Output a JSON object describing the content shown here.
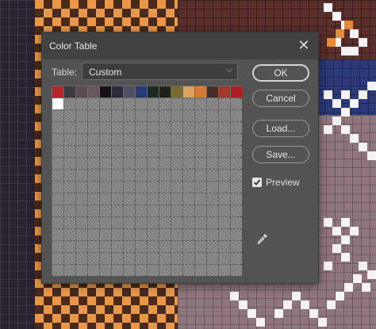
{
  "dialog": {
    "title": "Color Table",
    "close_icon": "close-icon",
    "table_label": "Table:",
    "table_value": "Custom",
    "buttons": {
      "ok": "OK",
      "cancel": "Cancel",
      "load": "Load...",
      "save": "Save..."
    },
    "preview": {
      "label": "Preview",
      "checked": true
    },
    "eyedropper_icon": "eyedropper-icon"
  },
  "swatches": {
    "colors": [
      "#b3262e",
      "#3c3a3e",
      "#5b4a52",
      "#6a585e",
      "#141214",
      "#2a2a3c",
      "#4d4f66",
      "#263a7a",
      "#1e2a20",
      "#1f2218",
      "#7a6a2e",
      "#e0a060",
      "#d87a30",
      "#4a2e26",
      "#a23a2a",
      "#b01e24"
    ],
    "second_row": [
      "#ffffff"
    ],
    "empty_color": "#8f8f8f",
    "total": 256
  }
}
